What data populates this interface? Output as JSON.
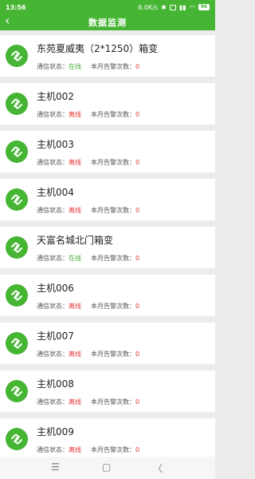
{
  "status_bar": {
    "time": "13:56",
    "net_speed": "6.0K/s",
    "battery": "96"
  },
  "header": {
    "title": "数据监测",
    "back_icon": "chevron-left-icon"
  },
  "labels": {
    "comm_status": "通信状态：",
    "alarm_count": "本月告警次数："
  },
  "colors": {
    "accent": "#46b534",
    "online": "#4aad3b",
    "offline": "#e53935"
  },
  "items": [
    {
      "name": "东苑夏威夷（2*1250）箱变",
      "status": "在线",
      "online": true,
      "alarms": "0"
    },
    {
      "name": "主机002",
      "status": "离线",
      "online": false,
      "alarms": "0"
    },
    {
      "name": "主机003",
      "status": "离线",
      "online": false,
      "alarms": "0"
    },
    {
      "name": "主机004",
      "status": "离线",
      "online": false,
      "alarms": "0"
    },
    {
      "name": "天富名城北门箱变",
      "status": "在线",
      "online": true,
      "alarms": "0"
    },
    {
      "name": "主机006",
      "status": "离线",
      "online": false,
      "alarms": "0"
    },
    {
      "name": "主机007",
      "status": "离线",
      "online": false,
      "alarms": "0"
    },
    {
      "name": "主机008",
      "status": "离线",
      "online": false,
      "alarms": "0"
    },
    {
      "name": "主机009",
      "status": "离线",
      "online": false,
      "alarms": "0"
    }
  ],
  "bottom_nav": {
    "menu_icon": "menu-icon",
    "home_icon": "home-square-icon",
    "back_icon": "back-triangle-icon",
    "menu": "☰",
    "home": "▢",
    "back": "〈"
  }
}
